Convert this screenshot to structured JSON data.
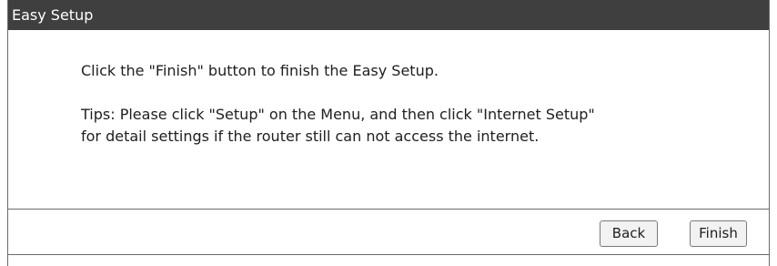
{
  "header": {
    "title": "Easy Setup"
  },
  "content": {
    "line1": "Click the \"Finish\" button to finish the Easy Setup.",
    "tip_line1": "Tips: Please click \"Setup\" on the Menu, and then click \"Internet Setup\"",
    "tip_line2": "for detail settings if the router still can not access the internet."
  },
  "buttons": {
    "back": "Back",
    "finish": "Finish"
  },
  "colors": {
    "title_bar": "#3f3f3f",
    "border": "#6a6a6a",
    "button_bg": "#f2f2f2"
  }
}
